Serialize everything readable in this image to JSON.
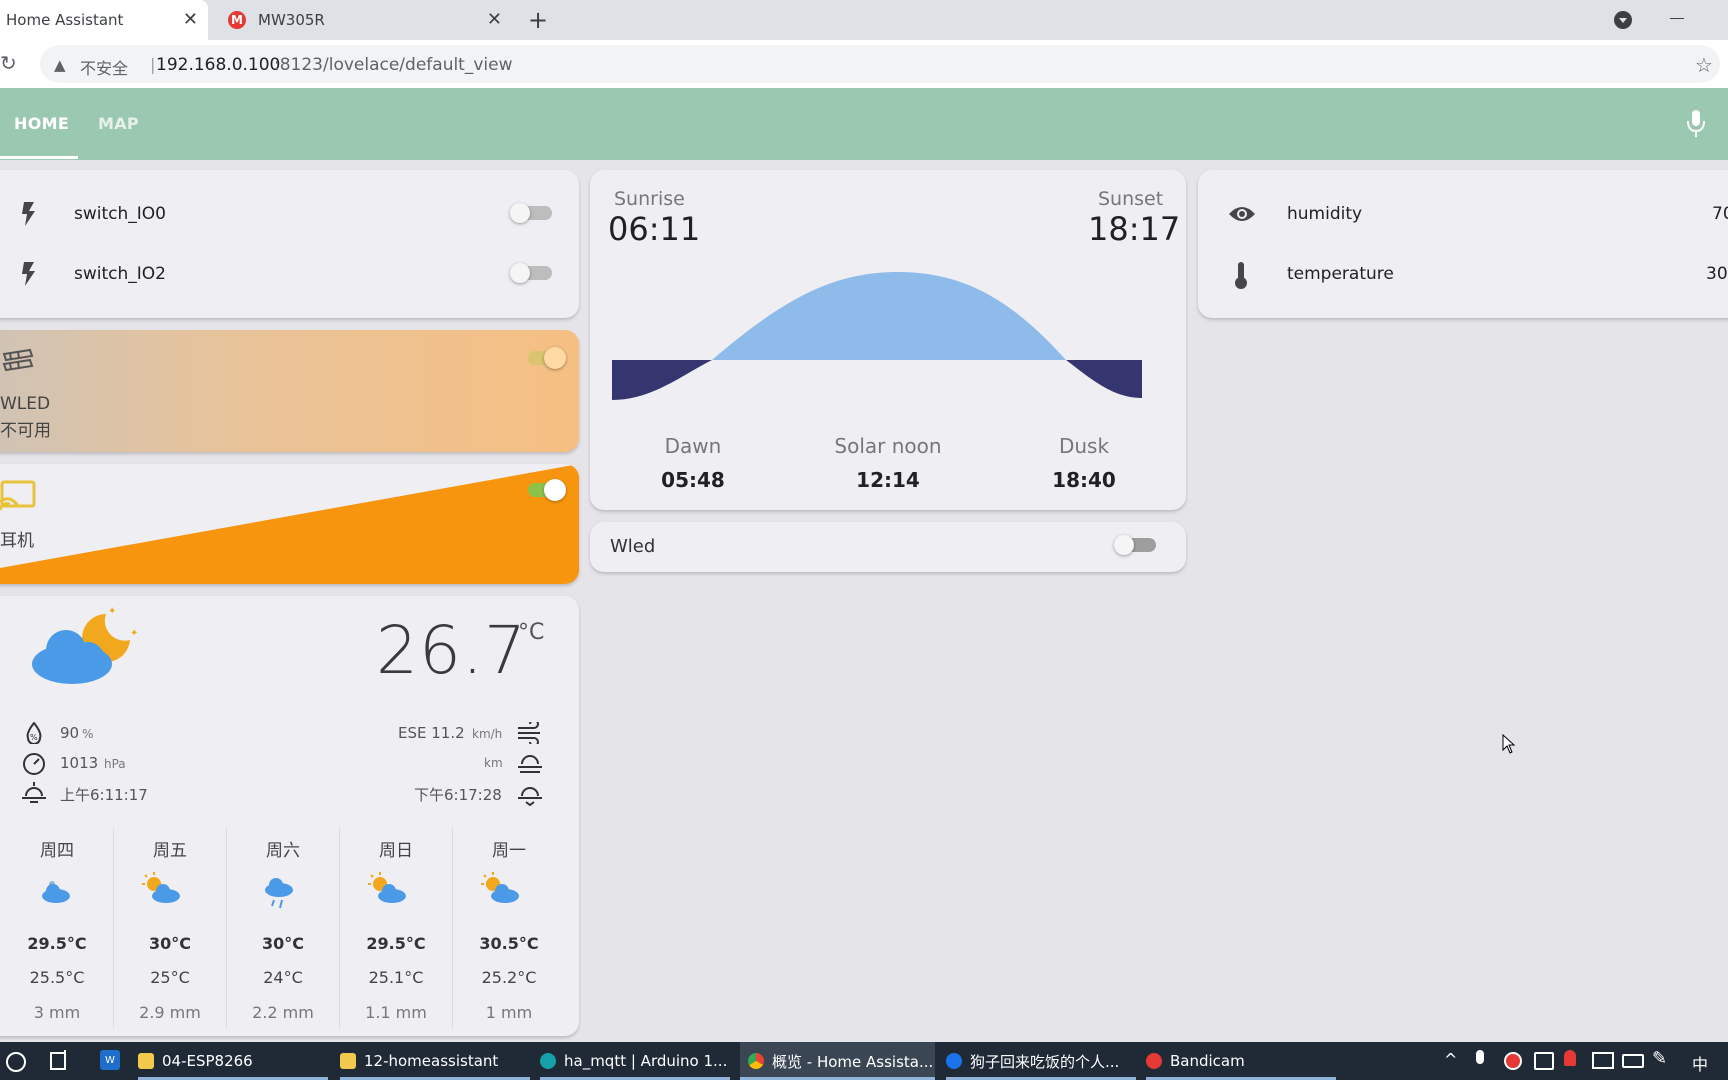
{
  "browser": {
    "tabs": [
      {
        "title": "Home Assistant",
        "active": true
      },
      {
        "title": "MW305R",
        "favicon": "M",
        "active": false
      }
    ],
    "address": {
      "security_label": "不安全",
      "separator": "|",
      "host": "192.168.0.100",
      "path": ":8123/lovelace/default_view"
    }
  },
  "header": {
    "tabs": [
      {
        "label": "HOME",
        "active": true
      },
      {
        "label": "MAP",
        "active": false
      }
    ],
    "color": "#9bc8b0"
  },
  "switch_card": {
    "entities": [
      {
        "name": "switch_IO0",
        "icon": "flash-icon",
        "state": "off"
      },
      {
        "name": "switch_IO2",
        "icon": "flash-icon",
        "state": "off"
      }
    ]
  },
  "wled_card": {
    "name": "WLED",
    "status": "不可用",
    "icon": "led-strip-icon"
  },
  "earphone_card": {
    "name": "耳机",
    "icon": "cast-icon",
    "state": "on"
  },
  "weather": {
    "temperature": "26.7",
    "unit": "°C",
    "humidity": "90",
    "humidity_unit": "%",
    "pressure": "1013",
    "pressure_unit": "hPa",
    "sunrise": "上午6:11:17",
    "wind": "ESE 11.2",
    "wind_unit": "km/h",
    "visibility_unit": "km",
    "sunset": "下午6:17:28",
    "forecast": [
      {
        "day": "周四",
        "high": "29.5°C",
        "low": "25.5°C",
        "precip": "3 mm",
        "icon": "cloudy-icon"
      },
      {
        "day": "周五",
        "high": "30°C",
        "low": "25°C",
        "precip": "2.9 mm",
        "icon": "partly-cloudy-icon"
      },
      {
        "day": "周六",
        "high": "30°C",
        "low": "24°C",
        "precip": "2.2 mm",
        "icon": "rainy-icon"
      },
      {
        "day": "周日",
        "high": "29.5°C",
        "low": "25.1°C",
        "precip": "1.1 mm",
        "icon": "partly-cloudy-icon"
      },
      {
        "day": "周一",
        "high": "30.5°C",
        "low": "25.2°C",
        "precip": "1 mm",
        "icon": "partly-cloudy-icon"
      }
    ]
  },
  "sun_card": {
    "sunrise_label": "Sunrise",
    "sunrise": "06:11",
    "sunset_label": "Sunset",
    "sunset": "18:17",
    "dawn_label": "Dawn",
    "dawn": "05:48",
    "noon_label": "Solar noon",
    "noon": "12:14",
    "dusk_label": "Dusk",
    "dusk": "18:40",
    "day_color": "#8fbbea",
    "night_color": "#353570"
  },
  "wled_switch": {
    "name": "Wled",
    "state": "off"
  },
  "sensor_card": {
    "entities": [
      {
        "name": "humidity",
        "value": "70",
        "icon": "eye-icon"
      },
      {
        "name": "temperature",
        "value": "30",
        "icon": "thermometer-icon"
      }
    ]
  },
  "taskbar": {
    "items": [
      {
        "label": "04-ESP8266"
      },
      {
        "label": "12-homeassistant"
      },
      {
        "label": "ha_mqtt | Arduino 1..."
      },
      {
        "label": "概览 - Home Assista..."
      },
      {
        "label": "狗子回来吃饭的个人..."
      },
      {
        "label": "Bandicam"
      }
    ],
    "ime": "中"
  }
}
